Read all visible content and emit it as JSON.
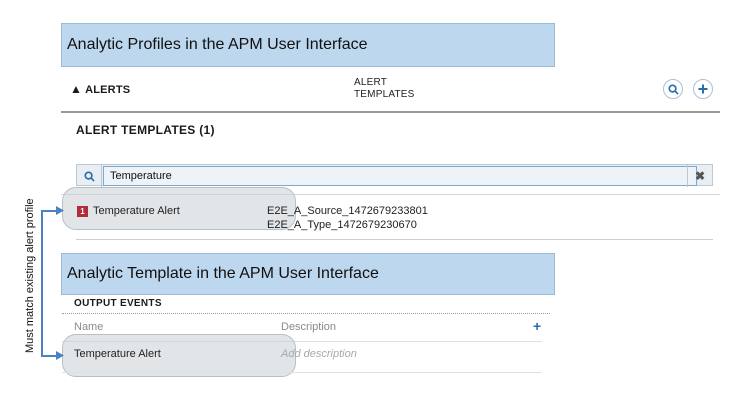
{
  "profiles_banner": "Analytic Profiles in the APM User Interface",
  "tabs": {
    "alerts_label": "ALERTS",
    "templates_line1": "ALERT",
    "templates_line2": "TEMPLATES"
  },
  "section_title": "ALERT TEMPLATES (1)",
  "search": {
    "value": "Temperature"
  },
  "result": {
    "badge": "1",
    "name": "Temperature Alert",
    "source": "E2E_A_Source_1472679233801",
    "type": "E2E_A_Type_1472679230670"
  },
  "template_banner": "Analytic Template in the APM User Interface",
  "output_events": {
    "title": "OUTPUT EVENTS",
    "col_name": "Name",
    "col_description": "Description",
    "row_name": "Temperature Alert",
    "row_description_placeholder": "Add description"
  },
  "side_note": "Must match existing alert profile",
  "colors": {
    "accent": "#2b6cb0",
    "banner": "#bdd7ee",
    "badge": "#b22d3a",
    "arrow": "#4a82c4"
  }
}
